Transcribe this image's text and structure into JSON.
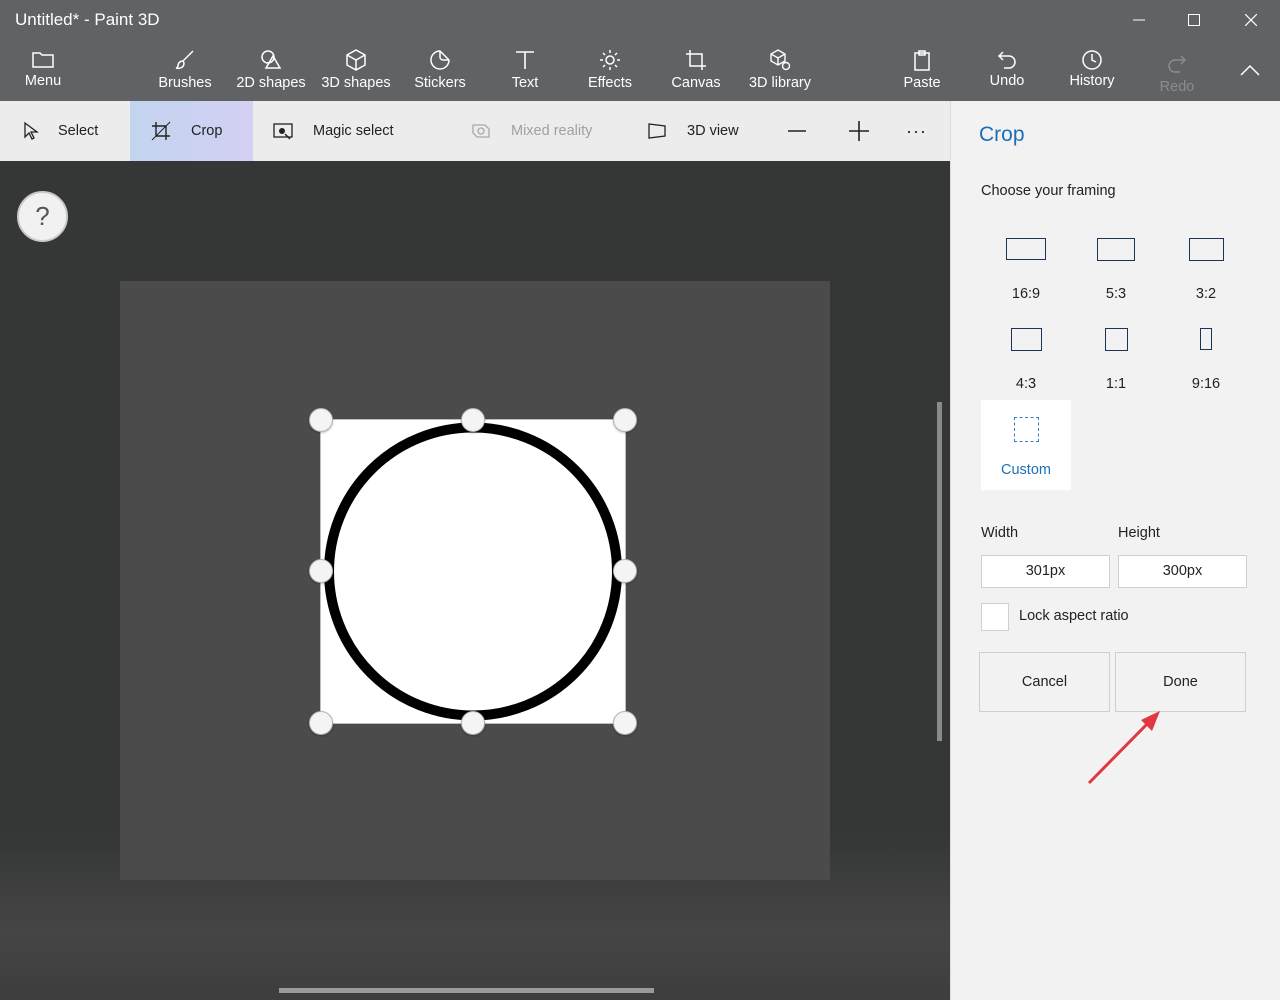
{
  "window": {
    "title": "Untitled* - Paint 3D"
  },
  "toolbar": {
    "menu": "Menu",
    "brushes": "Brushes",
    "shapes2d": "2D shapes",
    "shapes3d": "3D shapes",
    "stickers": "Stickers",
    "text": "Text",
    "effects": "Effects",
    "canvas": "Canvas",
    "library3d": "3D library",
    "paste": "Paste",
    "undo": "Undo",
    "history": "History",
    "redo": "Redo"
  },
  "subtoolbar": {
    "select": "Select",
    "crop": "Crop",
    "magic_select": "Magic select",
    "mixed_reality": "Mixed reality",
    "view3d": "3D view",
    "more": "···"
  },
  "help": {
    "label": "?"
  },
  "panel": {
    "title": "Crop",
    "framing_label": "Choose your framing",
    "framings": [
      {
        "label": "16:9",
        "icon": "rect-16-9-icon"
      },
      {
        "label": "5:3",
        "icon": "rect-5-3-icon"
      },
      {
        "label": "3:2",
        "icon": "rect-3-2-icon"
      },
      {
        "label": "4:3",
        "icon": "rect-4-3-icon"
      },
      {
        "label": "1:1",
        "icon": "square-icon"
      },
      {
        "label": "9:16",
        "icon": "rect-9-16-icon"
      },
      {
        "label": "Custom",
        "icon": "dashed-rect-icon",
        "selected": true
      }
    ],
    "width_label": "Width",
    "height_label": "Height",
    "width_value": "301px",
    "height_value": "300px",
    "lock_label": "Lock aspect ratio",
    "lock_checked": false,
    "cancel": "Cancel",
    "done": "Done"
  },
  "colors": {
    "accent": "#1d6fb5",
    "titlebar": "#606265",
    "annotation_arrow": "#e0383e"
  }
}
